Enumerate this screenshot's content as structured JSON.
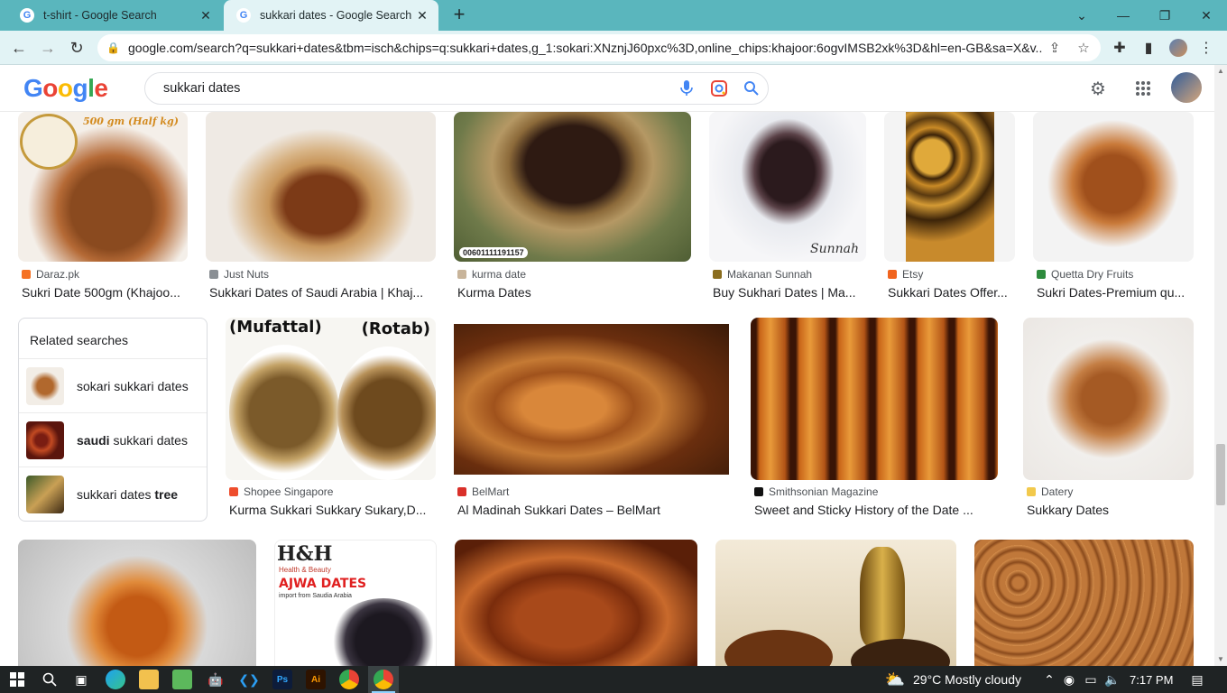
{
  "browser": {
    "tabs": [
      {
        "title": "t-shirt - Google Search"
      },
      {
        "title": "sukkari dates - Google Search"
      }
    ],
    "url": "google.com/search?q=sukkari+dates&tbm=isch&chips=q:sukkari+dates,g_1:sokari:XNznjJ60pxc%3D,online_chips:khajoor:6ogvIMSB2xk%3D&hl=en-GB&sa=X&v..."
  },
  "google": {
    "logo": [
      "G",
      "o",
      "o",
      "g",
      "l",
      "e"
    ],
    "query": "sukkari dates"
  },
  "results": {
    "row1": [
      {
        "source": "Daraz.pk",
        "title": "Sukri Date 500gm (Khajoo...",
        "source_color": "#f57224",
        "overlay": "500 gm (Half kg)"
      },
      {
        "source": "Just Nuts",
        "title": "Sukkari Dates of Saudi Arabia | Khaj...",
        "source_color": "#8a8f94"
      },
      {
        "source": "kurma date",
        "title": "Kurma Dates",
        "source_color": "#c8b49a",
        "overlay": "00601111191157"
      },
      {
        "source": "Makanan Sunnah",
        "title": "Buy Sukhari Dates | Ma...",
        "source_color": "#8a6d1e",
        "overlay": "Sunnah"
      },
      {
        "source": "Etsy",
        "title": "Sukkari Dates Offer...",
        "source_color": "#f1641e"
      },
      {
        "source": "Quetta Dry Fruits",
        "title": "Sukri Dates-Premium qu...",
        "source_color": "#2e8b3d"
      }
    ],
    "related": {
      "heading": "Related searches",
      "items": [
        {
          "prefix_bold": "",
          "text": "sokari sukkari dates",
          "suffix_bold": ""
        },
        {
          "prefix_bold": "saudi",
          "text": " sukkari dates",
          "suffix_bold": ""
        },
        {
          "prefix_bold": "",
          "text": "sukkari dates ",
          "suffix_bold": "tree"
        }
      ]
    },
    "row2": [
      {
        "source": "Shopee Singapore",
        "title": "Kurma Sukkari Sukkary Sukary,D...",
        "source_color": "#ee4d2d",
        "overlay_left": "(Mufattal)",
        "overlay_right": "(Rotab)"
      },
      {
        "source": "BelMart",
        "title": "Al Madinah Sukkari Dates – BelMart",
        "source_color": "#d9302a"
      },
      {
        "source": "Smithsonian Magazine",
        "title": "Sweet and Sticky History of the Date ...",
        "source_color": "#111111"
      },
      {
        "source": "Datery",
        "title": "Sukkary Dates",
        "source_color": "#f2c94c"
      }
    ],
    "row3": [
      {
        "label": ""
      },
      {
        "label": "H&H",
        "sub": "Health & Beauty",
        "overlay": "AJWA DATES",
        "overlay_sub": "import from Saudia Arabia"
      },
      {
        "label": ""
      },
      {
        "label": ""
      },
      {
        "label": ""
      }
    ]
  },
  "taskbar": {
    "weather": "29°C  Mostly cloudy",
    "time": "7:17 PM"
  }
}
